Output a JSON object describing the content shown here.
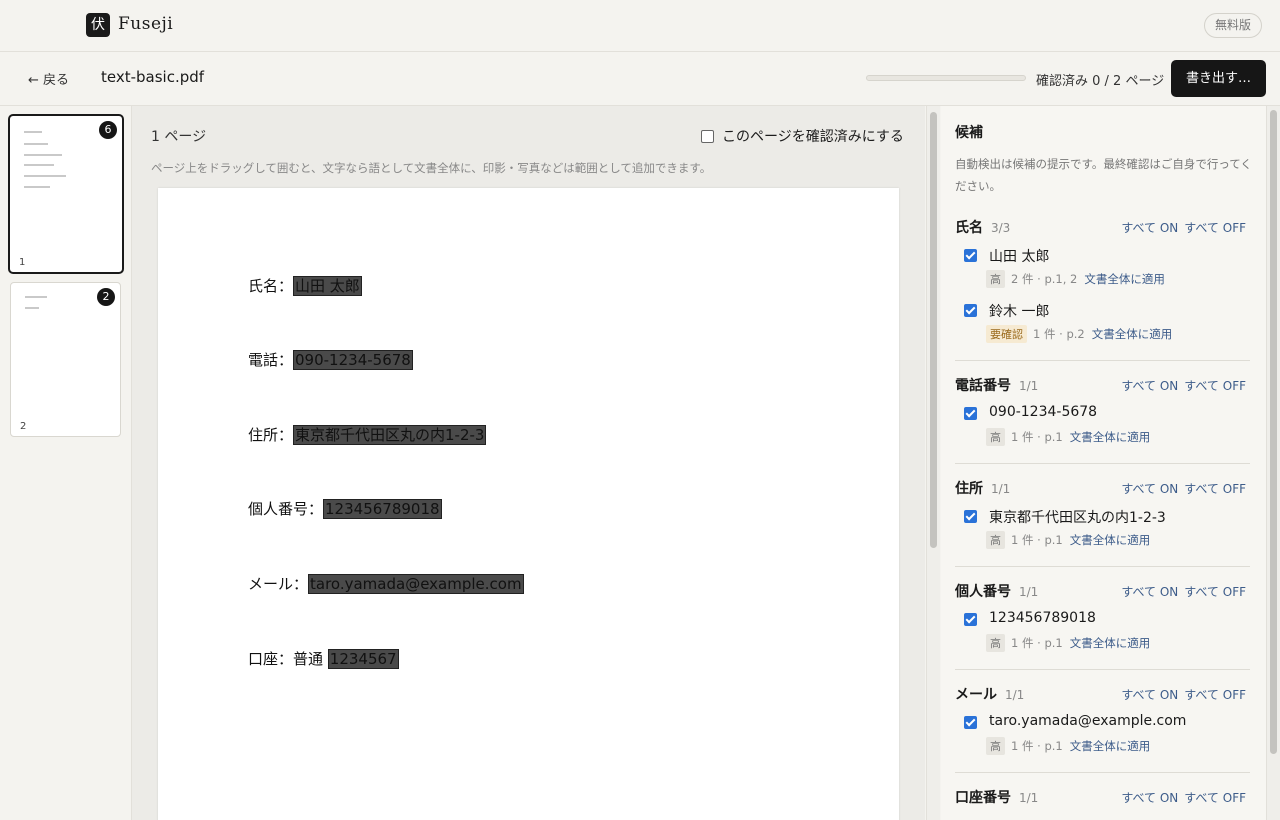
{
  "app": {
    "logo_char": "伏",
    "name": "Fuseji",
    "plan_badge": "無料版"
  },
  "filebar": {
    "back_label": "← 戻る",
    "file_name": "text-basic.pdf",
    "progress": 0,
    "progress_text": "確認済み 0 / 2 ページ",
    "export_label": "書き出す…"
  },
  "thumbnails": [
    {
      "page": "1",
      "badge": "6",
      "active": true
    },
    {
      "page": "2",
      "badge": "2",
      "active": false
    }
  ],
  "workspace": {
    "page_label": "1 ページ",
    "confirm_label": "このページを確認済みにする",
    "hint": "ページ上をドラッグして囲むと、文字なら語として文書全体に、印影・写真などは範囲として追加できます。",
    "lines": [
      {
        "label": "氏名：",
        "value": "山田 太郎"
      },
      {
        "label": "電話：",
        "value": "090-1234-5678"
      },
      {
        "label": "住所：",
        "value": "東京都千代田区丸の内1-2-3"
      },
      {
        "label": "個人番号：",
        "value": "123456789018"
      },
      {
        "label": "メール：",
        "value": "taro.yamada@example.com"
      },
      {
        "label": "口座：普通 ",
        "value": "1234567"
      }
    ]
  },
  "panel": {
    "title": "候補",
    "note": "自動検出は候補の提示です。最終確認はご自身で行ってください。",
    "all_on": "すべて ON",
    "all_off": "すべて OFF",
    "apply_label": "文書全体に適用",
    "groups": [
      {
        "name": "氏名",
        "count": "3/3",
        "items": [
          {
            "value": "山田 太郎",
            "confidence": "高",
            "meta": "2 件 · p.1, 2"
          },
          {
            "value": "鈴木 一郎",
            "confidence": "要確認",
            "meta": "1 件 · p.2"
          }
        ]
      },
      {
        "name": "電話番号",
        "count": "1/1",
        "items": [
          {
            "value": "090-1234-5678",
            "confidence": "高",
            "meta": "1 件 · p.1"
          }
        ]
      },
      {
        "name": "住所",
        "count": "1/1",
        "items": [
          {
            "value": "東京都千代田区丸の内1-2-3",
            "confidence": "高",
            "meta": "1 件 · p.1"
          }
        ]
      },
      {
        "name": "個人番号",
        "count": "1/1",
        "items": [
          {
            "value": "123456789018",
            "confidence": "高",
            "meta": "1 件 · p.1"
          }
        ]
      },
      {
        "name": "メール",
        "count": "1/1",
        "items": [
          {
            "value": "taro.yamada@example.com",
            "confidence": "高",
            "meta": "1 件 · p.1"
          }
        ]
      },
      {
        "name": "口座番号",
        "count": "1/1",
        "items": []
      }
    ]
  }
}
